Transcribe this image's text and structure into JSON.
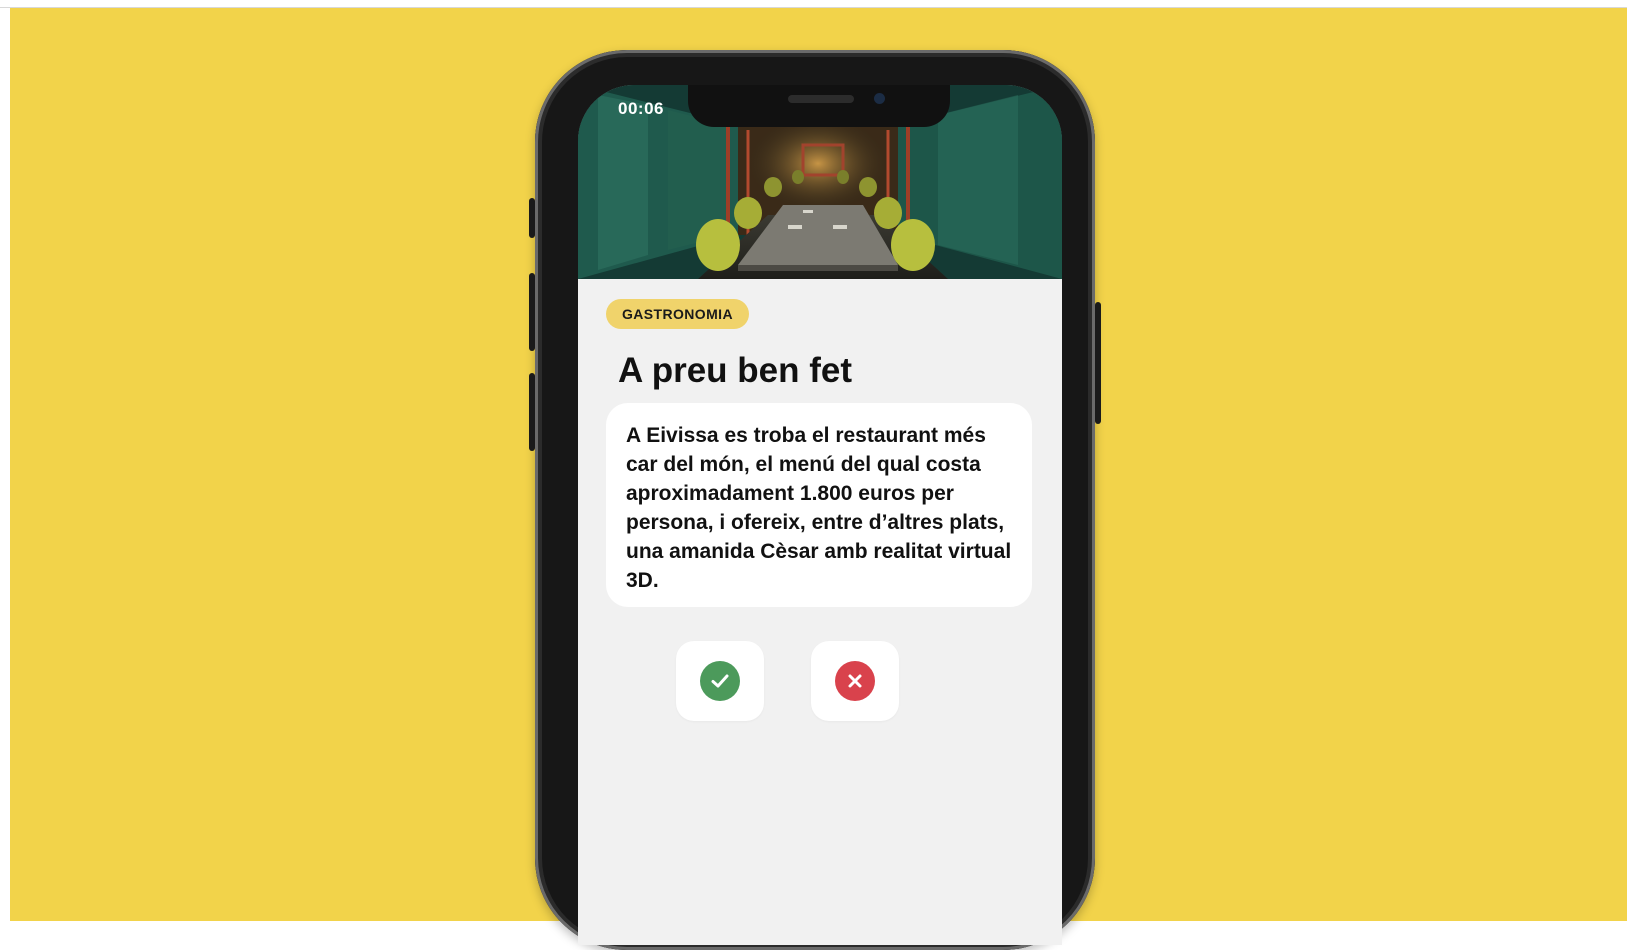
{
  "status_bar": {
    "time": "00:06"
  },
  "article": {
    "category": "GASTRONOMIA",
    "title": "A preu ben fet",
    "body": "A Eivissa es troba el restaurant més car del món, el menú del qual costa aproximadament 1.800 euros per persona, i ofereix, entre d’altres plats, una amanida Cèsar amb realitat virtual 3D."
  },
  "actions": {
    "true_icon": "check-icon",
    "false_icon": "close-icon",
    "true_color": "#4c9a5b",
    "false_color": "#d9424c"
  },
  "colors": {
    "background": "#f2d34a",
    "badge": "#f0d36b",
    "screen": "#f1f1f1"
  }
}
